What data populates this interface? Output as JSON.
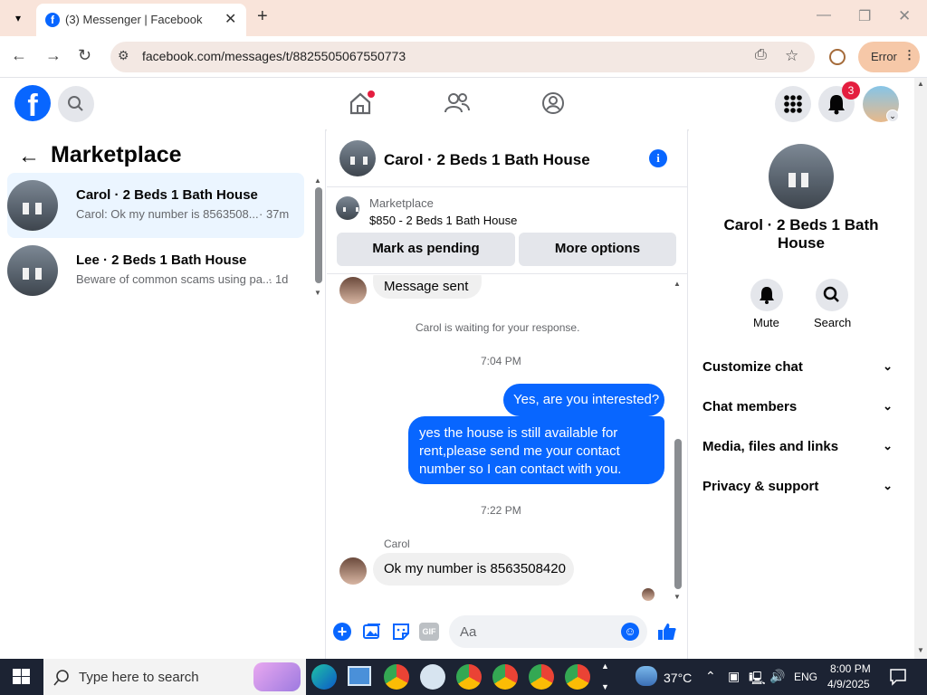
{
  "browser": {
    "tab_title": "(3) Messenger | Facebook",
    "url": "facebook.com/messages/t/8825505067550773",
    "error_label": "Error"
  },
  "fb_header": {
    "notif_badge": "3"
  },
  "left": {
    "title": "Marketplace",
    "conversations": [
      {
        "name": "Carol · 2 Beds 1 Bath House",
        "preview": "Carol: Ok my number is 8563508...",
        "time": "· 37m"
      },
      {
        "name": "Lee · 2 Beds 1 Bath House",
        "preview": "Beware of common scams using pa...",
        "time": "· 1d"
      }
    ]
  },
  "chat": {
    "title": "Carol · 2 Beds 1 Bath House",
    "listing_source": "Marketplace",
    "listing_price": "$850 - 2 Beds 1 Bath House",
    "mark_pending": "Mark as pending",
    "more_options": "More options",
    "msg_sent": "Message sent",
    "waiting": "Carol is waiting for your response.",
    "time1": "7:04 PM",
    "out1": "Yes, are you interested?",
    "out2": "yes the house is still available for rent,please send me your contact number so I can contact with you.",
    "time2": "7:22 PM",
    "sender": "Carol",
    "in1": "Ok my number is 8563508420",
    "composer_placeholder": "Aa"
  },
  "info": {
    "title": "Carol · 2 Beds 1 Bath House",
    "mute": "Mute",
    "search": "Search",
    "sections": [
      "Customize chat",
      "Chat members",
      "Media, files and links",
      "Privacy & support"
    ]
  },
  "taskbar": {
    "search_placeholder": "Type here to search",
    "weather": "37°C",
    "lang": "ENG",
    "time": "8:00 PM",
    "date": "4/9/2025"
  }
}
